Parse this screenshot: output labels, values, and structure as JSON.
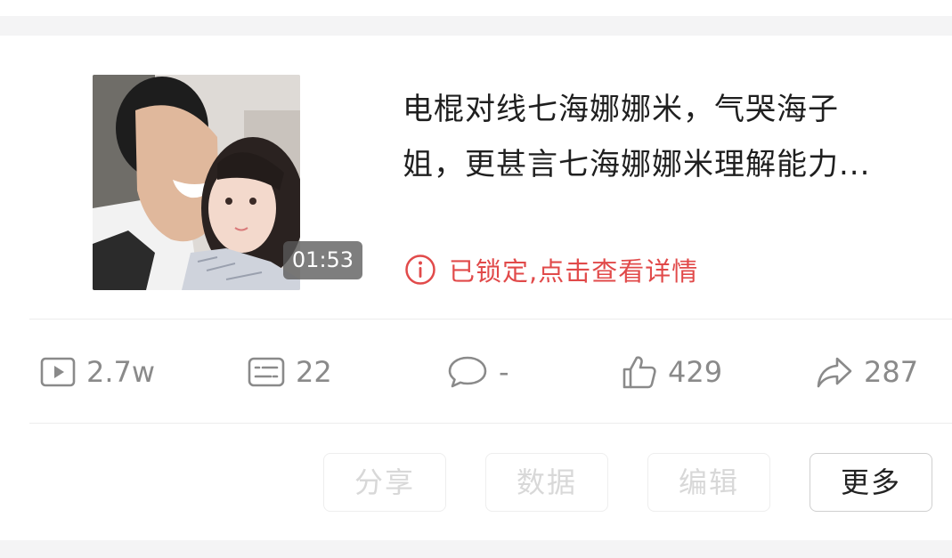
{
  "video": {
    "duration": "01:53",
    "title_line1": "电棍对线七海娜娜米，气哭海子",
    "title_line2": "姐，更甚言七海娜娜米理解能力...",
    "lock_icon": "info-circle-icon",
    "status_text": "已锁定,点击查看详情",
    "status_color": "#e14a4a"
  },
  "stats": {
    "plays": "2.7w",
    "danmaku": "22",
    "comments": "-",
    "likes": "429",
    "shares": "287"
  },
  "actions": {
    "share_label": "分享",
    "data_label": "数据",
    "edit_label": "编辑",
    "more_label": "更多"
  }
}
